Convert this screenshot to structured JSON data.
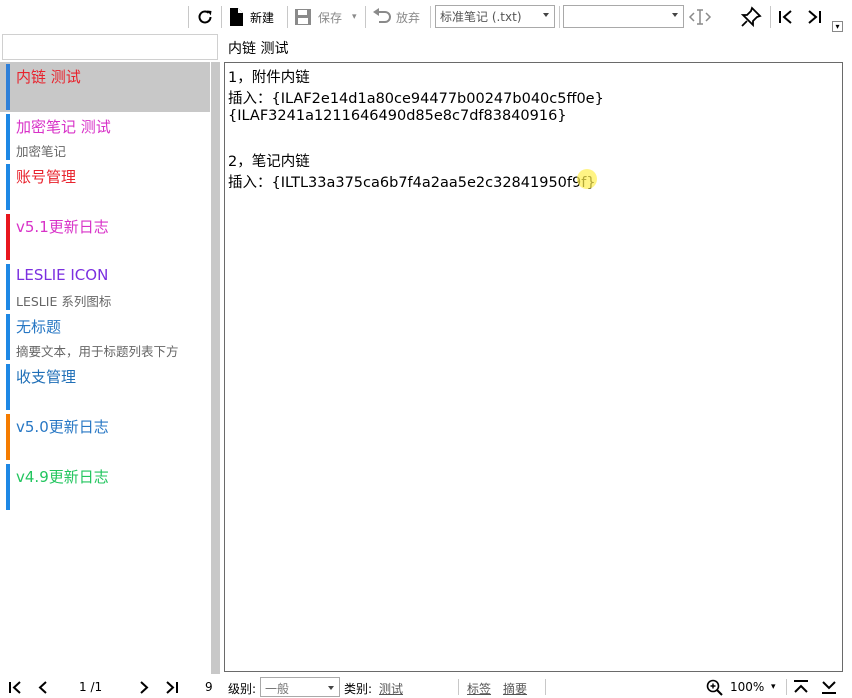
{
  "toolbar": {
    "new_label": "新建",
    "save_label": "保存",
    "discard_label": "放弃",
    "format_select": "标准笔记 (.txt)",
    "second_select": ""
  },
  "note": {
    "title": "内链 测试",
    "lines": [
      "1，附件内链",
      "插入：{ILAF2e14d1a80ce94477b00247b040c5ff0e}",
      "{ILAF3241a1211646490d85e8c7df83840916}",
      "",
      "2，笔记内链",
      "插入：{ILTL33a375ca6b7f4a2aa5e2c32841950f9f}"
    ]
  },
  "list": {
    "items": [
      {
        "title": "内链 测试",
        "subtitle": "",
        "title_color": "#e8232d",
        "bar_color": "#2f7fd8",
        "selected": true
      },
      {
        "title": "加密笔记 测试",
        "subtitle": "加密笔记",
        "title_color": "#d832c8",
        "bar_color": "#1e88e5",
        "selected": false
      },
      {
        "title": "账号管理",
        "subtitle": "",
        "title_color": "#e8232d",
        "bar_color": "#1e88e5",
        "selected": false
      },
      {
        "title": "v5.1更新日志",
        "subtitle": "",
        "title_color": "#d832c8",
        "bar_color": "#e8161d",
        "selected": false
      },
      {
        "title": "LESLIE ICON",
        "subtitle": "LESLIE 系列图标",
        "title_color": "#7b2fe0",
        "bar_color": "#1e88e5",
        "selected": false
      },
      {
        "title": "无标题",
        "subtitle": "摘要文本，用于标题列表下方",
        "title_color": "#2777c4",
        "bar_color": "#1e88e5",
        "selected": false
      },
      {
        "title": "收支管理",
        "subtitle": "",
        "title_color": "#1f6fb7",
        "bar_color": "#1e88e5",
        "selected": false
      },
      {
        "title": "v5.0更新日志",
        "subtitle": "",
        "title_color": "#2777c4",
        "bar_color": "#f57c00",
        "selected": false
      },
      {
        "title": "v4.9更新日志",
        "subtitle": "",
        "title_color": "#22c55e",
        "bar_color": "#1e88e5",
        "selected": false
      }
    ]
  },
  "status": {
    "page": "1 /1",
    "count": "9",
    "level_label": "级别:",
    "level_value": "一般",
    "category_label": "类别:",
    "category_value": "测试",
    "tags_label": "标签",
    "summary_label": "摘要",
    "zoom": "100%"
  }
}
